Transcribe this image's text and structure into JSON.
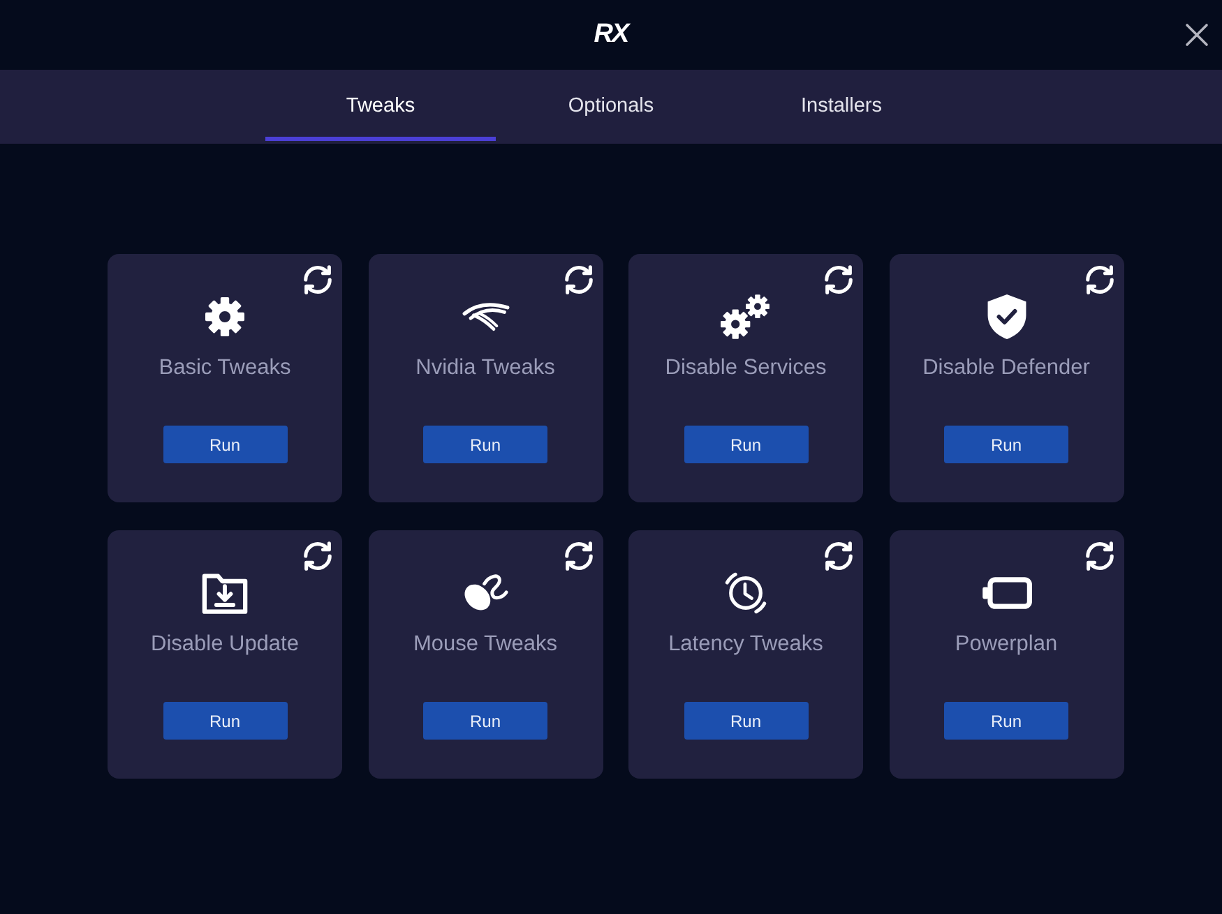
{
  "window": {
    "logo": "RX"
  },
  "tabs": [
    {
      "label": "Tweaks",
      "selected": true
    },
    {
      "label": "Optionals",
      "selected": false
    },
    {
      "label": "Installers",
      "selected": false
    }
  ],
  "cards": [
    {
      "kind": "gear",
      "title": "Basic Tweaks",
      "button": "Run"
    },
    {
      "kind": "swoosh",
      "title": "Nvidia Tweaks",
      "button": "Run"
    },
    {
      "kind": "gears",
      "title": "Disable Services",
      "button": "Run"
    },
    {
      "kind": "shield",
      "title": "Disable Defender",
      "button": "Run"
    },
    {
      "kind": "folder",
      "title": "Disable Update",
      "button": "Run"
    },
    {
      "kind": "mouse",
      "title": "Mouse Tweaks",
      "button": "Run"
    },
    {
      "kind": "clock",
      "title": "Latency Tweaks",
      "button": "Run"
    },
    {
      "kind": "battery",
      "title": "Powerplan",
      "button": "Run"
    }
  ]
}
